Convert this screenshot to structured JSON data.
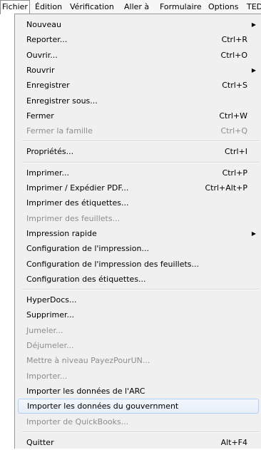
{
  "menubar": {
    "items": [
      "Fichier",
      "Édition",
      "Vérification",
      "Aller à",
      "Formulaire",
      "Options",
      "TED"
    ]
  },
  "menu": {
    "groups": [
      [
        {
          "label": "Nouveau",
          "shortcut": "",
          "submenu": true,
          "disabled": false
        },
        {
          "label": "Reporter...",
          "shortcut": "Ctrl+R",
          "submenu": false,
          "disabled": false
        },
        {
          "label": "Ouvrir...",
          "shortcut": "Ctrl+O",
          "submenu": false,
          "disabled": false
        },
        {
          "label": "Rouvrir",
          "shortcut": "",
          "submenu": true,
          "disabled": false
        },
        {
          "label": "Enregistrer",
          "shortcut": "Ctrl+S",
          "submenu": false,
          "disabled": false
        },
        {
          "label": "Enregistrer sous...",
          "shortcut": "",
          "submenu": false,
          "disabled": false
        },
        {
          "label": "Fermer",
          "shortcut": "Ctrl+W",
          "submenu": false,
          "disabled": false
        },
        {
          "label": "Fermer la famille",
          "shortcut": "Ctrl+Q",
          "submenu": false,
          "disabled": true
        }
      ],
      [
        {
          "label": "Propriétés...",
          "shortcut": "Ctrl+I",
          "submenu": false,
          "disabled": false
        }
      ],
      [
        {
          "label": "Imprimer...",
          "shortcut": "Ctrl+P",
          "submenu": false,
          "disabled": false
        },
        {
          "label": "Imprimer / Expédier PDF...",
          "shortcut": "Ctrl+Alt+P",
          "submenu": false,
          "disabled": false
        },
        {
          "label": "Imprimer des étiquettes...",
          "shortcut": "",
          "submenu": false,
          "disabled": false
        },
        {
          "label": "Imprimer des feuillets...",
          "shortcut": "",
          "submenu": false,
          "disabled": true
        },
        {
          "label": "Impression rapide",
          "shortcut": "",
          "submenu": true,
          "disabled": false
        },
        {
          "label": "Configuration de l'impression...",
          "shortcut": "",
          "submenu": false,
          "disabled": false
        },
        {
          "label": "Configuration de l'impression des feuillets...",
          "shortcut": "",
          "submenu": false,
          "disabled": false
        },
        {
          "label": "Configuration des étiquettes...",
          "shortcut": "",
          "submenu": false,
          "disabled": false
        }
      ],
      [
        {
          "label": "HyperDocs...",
          "shortcut": "",
          "submenu": false,
          "disabled": false
        },
        {
          "label": "Supprimer...",
          "shortcut": "",
          "submenu": false,
          "disabled": false
        },
        {
          "label": "Jumeler...",
          "shortcut": "",
          "submenu": false,
          "disabled": true
        },
        {
          "label": "Déjumeler...",
          "shortcut": "",
          "submenu": false,
          "disabled": true
        },
        {
          "label": "Mettre à niveau PayezPourUN...",
          "shortcut": "",
          "submenu": false,
          "disabled": true
        },
        {
          "label": "Importer...",
          "shortcut": "",
          "submenu": false,
          "disabled": true
        },
        {
          "label": "Importer les données de l'ARC",
          "shortcut": "",
          "submenu": false,
          "disabled": false
        },
        {
          "label": "Importer les données du gouvernment",
          "shortcut": "",
          "submenu": false,
          "disabled": false,
          "highlighted": true
        },
        {
          "label": "Importer de QuickBooks...",
          "shortcut": "",
          "submenu": false,
          "disabled": true
        }
      ],
      [
        {
          "label": "Quitter",
          "shortcut": "Alt+F4",
          "submenu": false,
          "disabled": false
        }
      ]
    ],
    "submenu_arrow": "▶"
  }
}
